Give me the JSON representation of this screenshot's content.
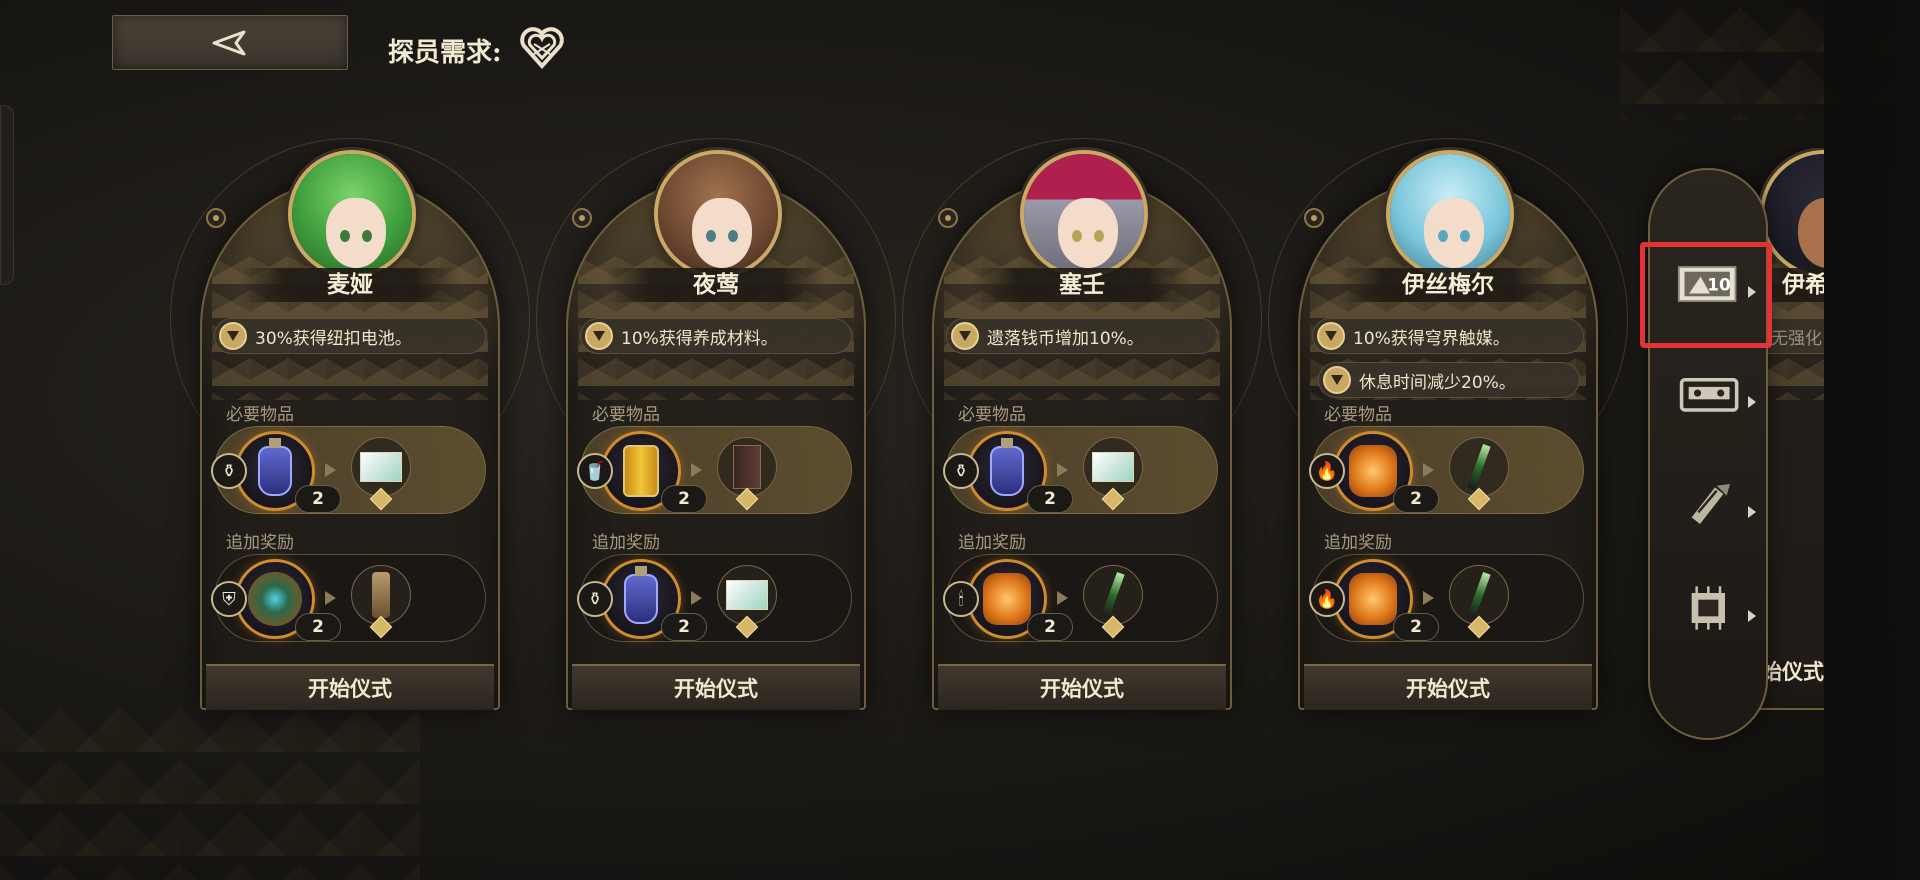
{
  "header": {
    "requirement_label": "探员需求:",
    "heart_icon": "heart-emblem-icon"
  },
  "labels": {
    "required": "必要物品",
    "bonus": "追加奖励",
    "start": "开始仪式"
  },
  "cards": [
    {
      "name": "麦娅",
      "traits": [
        "30%获得纽扣电池。"
      ],
      "required": {
        "item": "potion-bottle",
        "count": "2",
        "result": "rainbow-card",
        "badge": "bottle-icon"
      },
      "bonus": {
        "item": "eye-relic",
        "count": "2",
        "result": "vial",
        "badge": "shield-icon"
      }
    },
    {
      "name": "夜莺",
      "traits": [
        "10%获得养成材料。"
      ],
      "required": {
        "item": "gold-can",
        "count": "2",
        "result": "book",
        "badge": "cup-icon"
      },
      "bonus": {
        "item": "potion-bottle",
        "count": "2",
        "result": "rainbow-card",
        "badge": "bottle-icon"
      }
    },
    {
      "name": "塞壬",
      "traits": [
        "遗落钱币增加10%。"
      ],
      "required": {
        "item": "potion-bottle",
        "count": "2",
        "result": "rainbow-card",
        "badge": "bottle-icon"
      },
      "bonus": {
        "item": "lantern",
        "count": "2",
        "result": "pen",
        "badge": "candle-icon"
      }
    },
    {
      "name": "伊丝梅尔",
      "traits": [
        "10%获得穹界触媒。",
        "休息时间减少20%。"
      ],
      "required": {
        "item": "lantern",
        "count": "2",
        "result": "pen",
        "badge": "flame-icon"
      },
      "bonus": {
        "item": "lantern",
        "count": "2",
        "result": "pen",
        "badge": "flame-icon"
      }
    }
  ],
  "partial_card": {
    "name": "伊希",
    "trait": "无强化"
  },
  "side_panel": {
    "filters": [
      {
        "icon": "ticket-10-icon",
        "label": "10",
        "selected": true
      },
      {
        "icon": "cassette-icon"
      },
      {
        "icon": "tool-icon"
      },
      {
        "icon": "chip-icon"
      }
    ]
  },
  "colors": {
    "accent_gold": "#c9a964",
    "highlight_red": "#e53236",
    "panel_dark": "#1f1c18"
  }
}
